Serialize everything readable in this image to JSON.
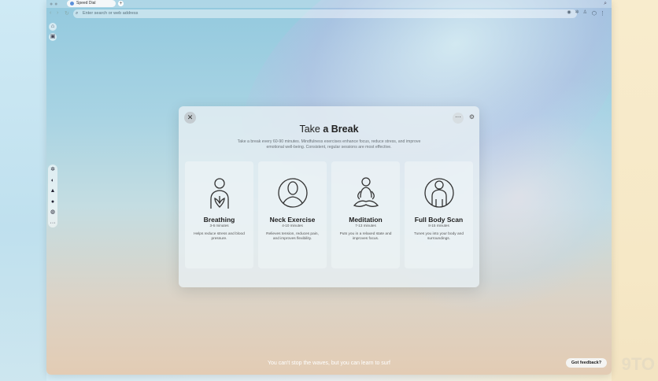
{
  "browser": {
    "tab_title": "Speed Dial",
    "address_placeholder": "Enter search or web address"
  },
  "modal": {
    "title_prefix": "Take",
    "title_bold": "a Break",
    "description": "Take a break every 60-90 minutes. Mindfulness exercises enhance focus, reduce stress, and improve emotional well-being. Consistent, regular sessions are most effective.",
    "cards": [
      {
        "title": "Breathing",
        "duration": "3-6 minutes",
        "text": "Helps reduce stress and blood pressure.",
        "icon": "breathing-lotus-icon"
      },
      {
        "title": "Neck Exercise",
        "duration": "4-10 minutes",
        "text": "Relieves tension, reduces pain, and improves flexibility.",
        "icon": "neck-person-icon"
      },
      {
        "title": "Meditation",
        "duration": "7-13 minutes",
        "text": "Puts you in a relaxed state and improves focus.",
        "icon": "meditation-icon"
      },
      {
        "title": "Full Body Scan",
        "duration": "8-15 minutes",
        "text": "Tunes you into your body and surroundings.",
        "icon": "body-scan-icon"
      }
    ]
  },
  "footer": {
    "quote": "You can't stop the waves, but you can learn to surf",
    "feedback_label": "Got feedback?"
  },
  "watermark": "9TO"
}
